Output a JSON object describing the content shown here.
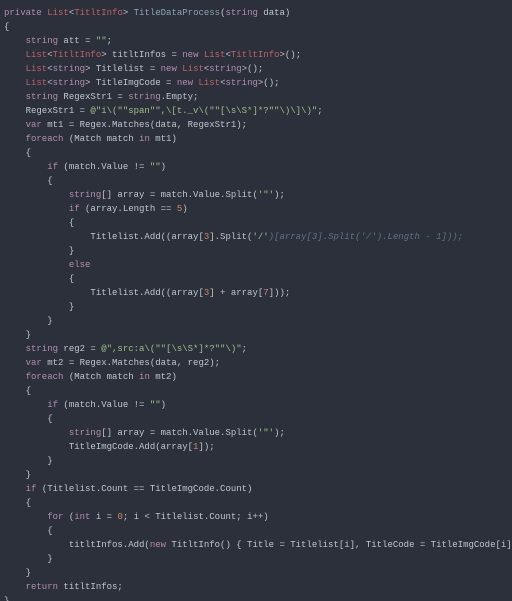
{
  "code": {
    "l01a": "private",
    "l01b": "List",
    "l01c": "TitltInfo",
    "l01d": "TitleDataProcess",
    "l01e": "string",
    "l01f": "data",
    "l02": "{",
    "l03a": "string",
    "l03b": "att = ",
    "l03c": "\"\"",
    "l03d": ";",
    "l04a": "List",
    "l04b": "TitltInfo",
    "l04c": "titltInfos = ",
    "l04d": "new",
    "l04e": "List",
    "l04f": "TitltInfo",
    "l04g": "();",
    "l05a": "List",
    "l05b": "string",
    "l05c": "Titlelist = ",
    "l05d": "new",
    "l05e": "List",
    "l05f": "string",
    "l05g": "();",
    "l06a": "List",
    "l06b": "string",
    "l06c": "TitleImgCode = ",
    "l06d": "new",
    "l06e": "List",
    "l06f": "string",
    "l06g": "();",
    "l07a": "string",
    "l07b": "RegexStr1 = ",
    "l07c": "string",
    "l07d": ".Empty;",
    "l08a": "RegexStr1 = ",
    "l08b": "@\"i\\(\"\"span\"\",\\[t._v\\(\"\"[\\s\\S*]*?\"\"\\)\\]\\)\"",
    "l08c": ";",
    "l09a": "var",
    "l09b": " mt1 = Regex.Matches(data, RegexStr1);",
    "l10a": "foreach",
    "l10b": " (Match match ",
    "l10c": "in",
    "l10d": " mt1)",
    "l11": "{",
    "l12a": "if",
    "l12b": " (match.Value != ",
    "l12c": "\"\"",
    "l12d": ")",
    "l13": "{",
    "l14a": "string",
    "l14b": "[] array = match.Value.Split(",
    "l14c": "'\"'",
    "l14d": ");",
    "l15a": "if",
    "l15b": " (array.Length == ",
    "l15c": "5",
    "l15d": ")",
    "l16": "{",
    "l17a": "Titlelist.Add((array[",
    "l17b": "3",
    "l17c": "].Split(",
    "l17d": "'/'",
    "l17e": ")[array[3].Split('/').Length - 1]));",
    "l18": "}",
    "l19": "else",
    "l20": "{",
    "l21a": "Titlelist.Add((array[",
    "l21b": "3",
    "l21c": "] + array[",
    "l21d": "7",
    "l21e": "]));",
    "l22": "}",
    "l23": "}",
    "l24": "}",
    "l25a": "string",
    "l25b": " reg2 = ",
    "l25c": "@\",src:a\\(\"\"[\\s\\S*]*?\"\"\\)\"",
    "l25d": ";",
    "l26a": "var",
    "l26b": " mt2 = Regex.Matches(data, reg2);",
    "l27a": "foreach",
    "l27b": " (Match match ",
    "l27c": "in",
    "l27d": " mt2)",
    "l28": "{",
    "l29a": "if",
    "l29b": " (match.Value != ",
    "l29c": "\"\"",
    "l29d": ")",
    "l30": "{",
    "l31a": "string",
    "l31b": "[] array = match.Value.Split(",
    "l31c": "'\"'",
    "l31d": ");",
    "l32": "TitleImgCode.Add(array[",
    "l32b": "1",
    "l32c": "]);",
    "l33": "}",
    "l34": "}",
    "l35a": "if",
    "l35b": " (Titlelist.Count == TitleImgCode.Count)",
    "l36": "{",
    "l37a": "for",
    "l37b": " (",
    "l37c": "int",
    "l37d": " i = ",
    "l37e": "0",
    "l37f": "; i < Titlelist.Count; i++)",
    "l38": "{",
    "l39a": "titltInfos.Add(",
    "l39b": "new",
    "l39c": " TitltInfo() { Title = Titlelist[i], TitleCode = TitleImgCode[i] });",
    "l40": "}",
    "l41": "}",
    "l42a": "return",
    "l42b": " titltInfos;",
    "l43": "}"
  }
}
